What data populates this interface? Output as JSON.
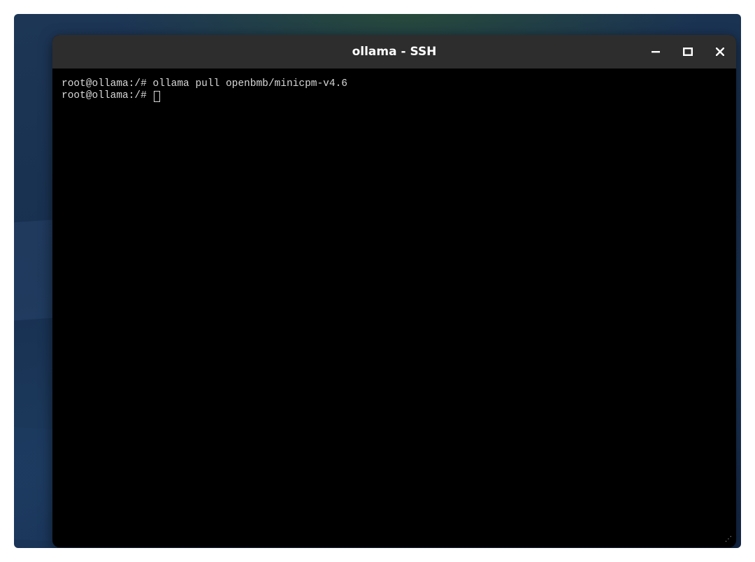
{
  "window": {
    "title": "ollama - SSH",
    "controls": {
      "minimize_icon": "minimize-icon",
      "maximize_icon": "maximize-icon",
      "close_icon": "close-icon"
    }
  },
  "terminal": {
    "lines": [
      {
        "prompt": "root@ollama:/# ",
        "command": "ollama pull openbmb/minicpm-v4.6"
      },
      {
        "prompt": "root@ollama:/# ",
        "command": ""
      }
    ],
    "colors": {
      "background": "#000000",
      "text": "#d8d8d8",
      "titlebar": "#2d2d2d"
    }
  }
}
